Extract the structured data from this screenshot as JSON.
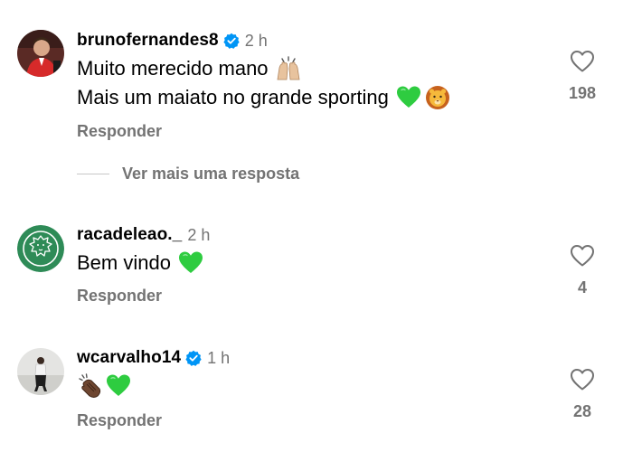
{
  "comments": [
    {
      "username": "brunofernandes8",
      "verified": true,
      "time": "2 h",
      "lines": [
        "Muito merecido mano",
        "Mais um maiato no grande sporting"
      ],
      "emojis": [
        [
          "raised-hands-emoji"
        ],
        [
          "green-heart-emoji",
          "lion-emoji"
        ]
      ],
      "reply_label": "Responder",
      "likes": "198"
    },
    {
      "username": "racadeleao._",
      "verified": false,
      "time": "2 h",
      "lines": [
        "Bem vindo"
      ],
      "emojis": [
        [
          "green-heart-emoji"
        ]
      ],
      "reply_label": "Responder",
      "likes": "4"
    },
    {
      "username": "wcarvalho14",
      "verified": true,
      "time": "1 h",
      "lines": [
        ""
      ],
      "emojis": [
        [
          "clapping-hands-emoji",
          "green-heart-emoji"
        ]
      ],
      "reply_label": "Responder",
      "likes": "28"
    }
  ],
  "more_replies_label": "Ver mais uma resposta",
  "colors": {
    "secondary_text": "#737373",
    "verified_blue": "#0095f6",
    "green_heart": "#2ecc40",
    "avatar_green": "#2e8b57"
  },
  "icons": {
    "like": "heart-outline-icon",
    "verified": "verified-badge-icon"
  }
}
